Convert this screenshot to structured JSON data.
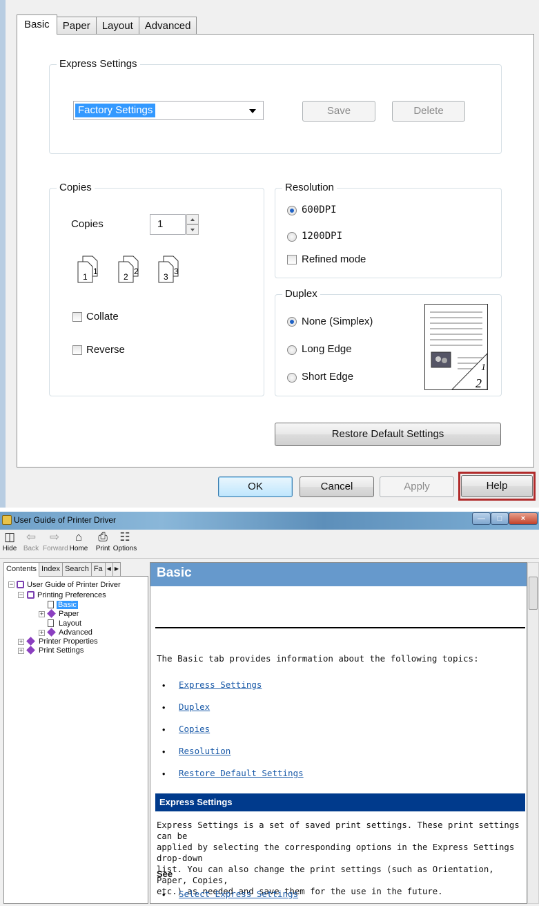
{
  "dialog": {
    "tabs": [
      "Basic",
      "Paper",
      "Layout",
      "Advanced"
    ],
    "express_settings": {
      "group_label": "Express Settings",
      "selected": "Factory Settings",
      "save_label": "Save",
      "delete_label": "Delete"
    },
    "copies": {
      "group_label": "Copies",
      "copies_label": "Copies",
      "copies_value": "1",
      "sheets": [
        {
          "page": "1",
          "copy": "1"
        },
        {
          "page": "2",
          "copy": "2"
        },
        {
          "page": "3",
          "copy": "3"
        }
      ],
      "collate_label": "Collate",
      "reverse_label": "Reverse"
    },
    "resolution": {
      "group_label": "Resolution",
      "options": [
        "600DPI",
        "1200DPI"
      ],
      "selected": "600DPI",
      "refined_label": "Refined mode"
    },
    "duplex": {
      "group_label": "Duplex",
      "options": [
        "None (Simplex)",
        "Long Edge",
        "Short Edge"
      ],
      "selected": "None (Simplex)",
      "preview_page_front": "1",
      "preview_page_back": "2"
    },
    "restore_label": "Restore Default Settings",
    "buttons": {
      "ok": "OK",
      "cancel": "Cancel",
      "apply": "Apply",
      "help": "Help"
    }
  },
  "viewer": {
    "title": "User Guide of Printer Driver",
    "toolbar": [
      "Hide",
      "Back",
      "Forward",
      "Home",
      "Print",
      "Options"
    ],
    "nav_tabs": [
      "Contents",
      "Index",
      "Search",
      "Fa"
    ],
    "tree": {
      "root": "User Guide of Printer Driver",
      "printing_preferences": "Printing Preferences",
      "basic": "Basic",
      "paper": "Paper",
      "layout": "Layout",
      "advanced": "Advanced",
      "printer_properties": "Printer Properties",
      "print_settings": "Print Settings"
    },
    "content": {
      "title": "Basic",
      "intro": "The Basic tab provides information about the following topics:",
      "links": [
        "Express Settings",
        "Duplex",
        "Copies",
        "Resolution",
        "Restore Default Settings"
      ],
      "section_title": "Express Settings",
      "paragraph": " Express Settings is a set of saved print settings. These print settings can be\napplied by selecting the corresponding options in the Express Settings drop-down\nlist. You can also change the print settings (such as Orientation, Paper, Copies,\netc.) as needed and save them for the use in the future.",
      "see_label": "See",
      "see_link": "Select Express Settings"
    }
  }
}
